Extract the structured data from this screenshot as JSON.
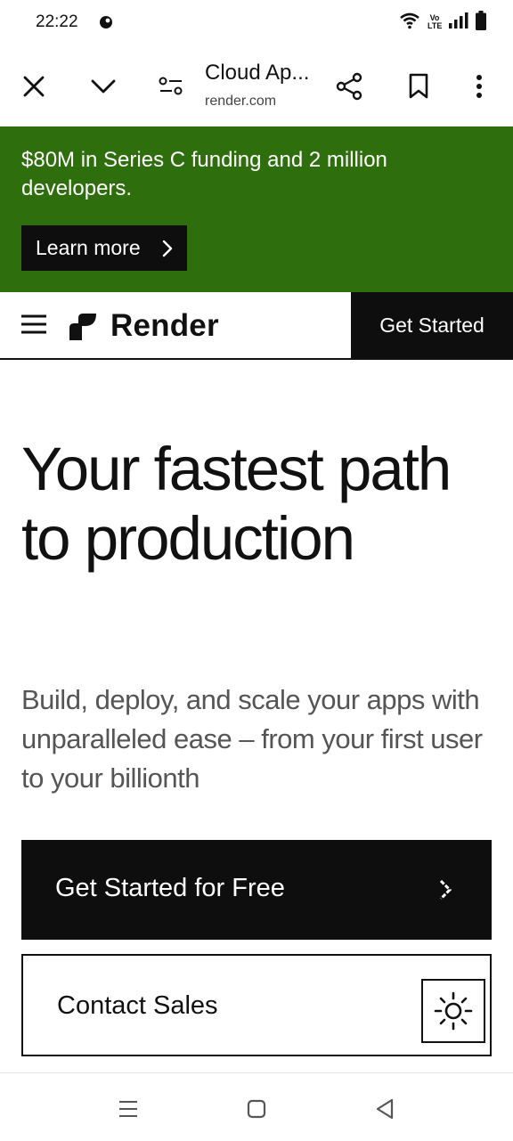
{
  "status_bar": {
    "time": "22:22",
    "network_label": "Vo LTE",
    "icons": [
      "app-notification-icon",
      "wifi-icon",
      "volte-icon",
      "signal-icon",
      "battery-icon"
    ]
  },
  "browser": {
    "page_title": "Cloud Ap...",
    "url": "render.com",
    "icons": [
      "close-icon",
      "chevron-down-icon",
      "page-settings-icon",
      "share-icon",
      "bookmark-icon",
      "more-vertical-icon"
    ]
  },
  "announcement": {
    "message": "$80M in Series C funding and 2 million developers.",
    "button_label": "Learn more",
    "background": "#2f6e0c"
  },
  "site_header": {
    "brand": "Render",
    "cta_label": "Get Started"
  },
  "hero": {
    "title": "Your fastest path to production",
    "subtitle": "Build, deploy, and scale your apps with unparalleled ease – from your first user to your billionth",
    "primary_cta": "Get Started for Free",
    "secondary_cta": "Contact Sales"
  },
  "android_nav": {
    "icons": [
      "recents-menu-icon",
      "home-icon",
      "back-icon"
    ]
  },
  "colors": {
    "accent_black": "#0e0e0e",
    "banner_green": "#2f6e0c",
    "muted_text": "#555555"
  }
}
